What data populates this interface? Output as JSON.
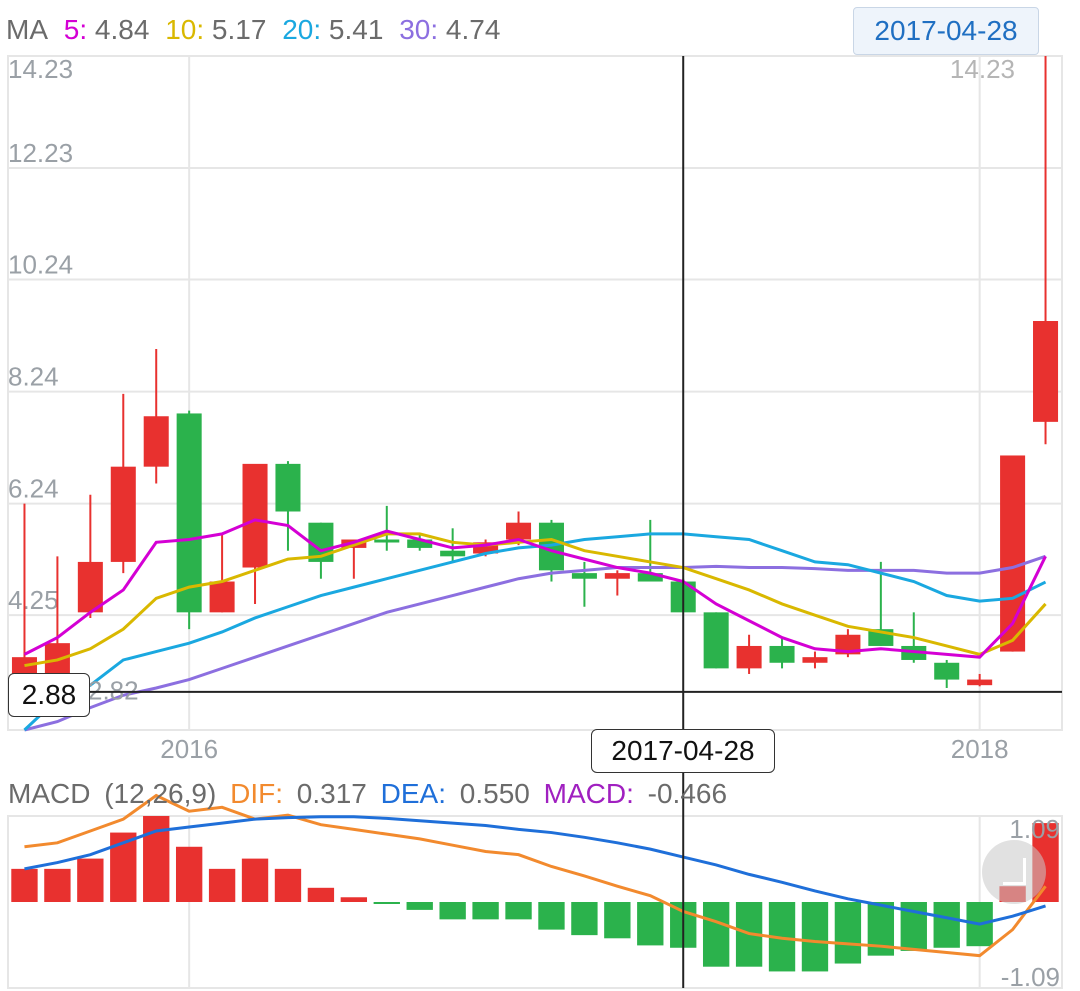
{
  "ma_legend": {
    "label": "MA",
    "ma5_label": "5:",
    "ma5_value": "4.84",
    "ma10_label": "10:",
    "ma10_value": "5.17",
    "ma20_label": "20:",
    "ma20_value": "5.41",
    "ma30_label": "30:",
    "ma30_value": "4.74"
  },
  "selected_date": "2017-04-28",
  "crosshair": {
    "x_label": "2017-04-28",
    "y_label": "2.88"
  },
  "macd_legend": {
    "label": "MACD",
    "params": "(12,26,9)",
    "dif_label": "DIF:",
    "dif_value": "0.317",
    "dea_label": "DEA:",
    "dea_value": "0.550",
    "macd_label": "MACD:",
    "macd_value": "-0.466"
  },
  "colors": {
    "up": "#e8312f",
    "down": "#2bb24c",
    "ma5": "#d400d4",
    "ma10": "#d9b800",
    "ma20": "#1aa8e0",
    "ma30": "#8c6fe0",
    "dif": "#f28a2e",
    "dea": "#1f6fd9",
    "grid": "#e6e6e6",
    "axis_text": "#9aa0a6",
    "crosshair": "#222222"
  },
  "chart_data": [
    {
      "type": "candlestick",
      "title": "",
      "y_ticks": [
        "14.23",
        "12.23",
        "10.24",
        "8.24",
        "6.24",
        "4.25"
      ],
      "y_right_tick": "14.23",
      "max_label": "14.23",
      "min_label": "2.82",
      "x_ticks": [
        "2016",
        "2018"
      ],
      "ylim": [
        2.2,
        14.23
      ],
      "candles": [
        {
          "o": 2.82,
          "h": 6.24,
          "l": 2.7,
          "c": 3.5
        },
        {
          "o": 3.2,
          "h": 5.3,
          "l": 3.0,
          "c": 3.75
        },
        {
          "o": 4.3,
          "h": 6.4,
          "l": 4.2,
          "c": 5.2
        },
        {
          "o": 5.2,
          "h": 8.2,
          "l": 5.0,
          "c": 6.9
        },
        {
          "o": 6.9,
          "h": 9.0,
          "l": 6.6,
          "c": 7.8
        },
        {
          "o": 7.85,
          "h": 7.9,
          "l": 4.0,
          "c": 4.3
        },
        {
          "o": 4.3,
          "h": 5.7,
          "l": 4.3,
          "c": 4.85
        },
        {
          "o": 5.1,
          "h": 6.9,
          "l": 4.45,
          "c": 6.95
        },
        {
          "o": 6.95,
          "h": 7.0,
          "l": 5.4,
          "c": 6.1
        },
        {
          "o": 5.9,
          "h": 5.9,
          "l": 4.9,
          "c": 5.2
        },
        {
          "o": 5.45,
          "h": 5.6,
          "l": 4.9,
          "c": 5.6
        },
        {
          "o": 5.6,
          "h": 6.2,
          "l": 5.4,
          "c": 5.55
        },
        {
          "o": 5.6,
          "h": 5.7,
          "l": 5.4,
          "c": 5.45
        },
        {
          "o": 5.4,
          "h": 5.8,
          "l": 5.2,
          "c": 5.3
        },
        {
          "o": 5.35,
          "h": 5.6,
          "l": 5.3,
          "c": 5.55
        },
        {
          "o": 5.6,
          "h": 6.1,
          "l": 5.5,
          "c": 5.9
        },
        {
          "o": 5.9,
          "h": 5.95,
          "l": 4.85,
          "c": 5.05
        },
        {
          "o": 5.0,
          "h": 5.2,
          "l": 4.4,
          "c": 4.9
        },
        {
          "o": 4.9,
          "h": 5.05,
          "l": 4.6,
          "c": 5.0
        },
        {
          "o": 5.0,
          "h": 5.95,
          "l": 4.9,
          "c": 4.85
        },
        {
          "o": 4.85,
          "h": 4.9,
          "l": 4.3,
          "c": 4.3
        },
        {
          "o": 4.3,
          "h": 4.3,
          "l": 3.3,
          "c": 3.3
        },
        {
          "o": 3.3,
          "h": 3.9,
          "l": 3.2,
          "c": 3.7
        },
        {
          "o": 3.7,
          "h": 3.85,
          "l": 3.3,
          "c": 3.4
        },
        {
          "o": 3.4,
          "h": 3.6,
          "l": 3.3,
          "c": 3.5
        },
        {
          "o": 3.55,
          "h": 4.0,
          "l": 3.5,
          "c": 3.9
        },
        {
          "o": 4.0,
          "h": 5.2,
          "l": 3.7,
          "c": 3.7
        },
        {
          "o": 3.7,
          "h": 4.3,
          "l": 3.4,
          "c": 3.45
        },
        {
          "o": 3.4,
          "h": 3.45,
          "l": 2.95,
          "c": 3.1
        },
        {
          "o": 3.0,
          "h": 3.2,
          "l": 2.98,
          "c": 3.1
        },
        {
          "o": 3.6,
          "h": 7.1,
          "l": 3.6,
          "c": 7.1
        },
        {
          "o": 7.7,
          "h": 14.23,
          "l": 7.3,
          "c": 9.5
        }
      ],
      "ma5": [
        3.55,
        3.85,
        4.3,
        4.7,
        5.55,
        5.6,
        5.7,
        5.95,
        5.85,
        5.4,
        5.55,
        5.75,
        5.6,
        5.45,
        5.5,
        5.6,
        5.4,
        5.25,
        5.1,
        5.0,
        4.85,
        4.45,
        4.15,
        3.85,
        3.65,
        3.6,
        3.65,
        3.6,
        3.55,
        3.5,
        4.1,
        5.3
      ],
      "ma10": [
        3.35,
        3.45,
        3.65,
        4.0,
        4.55,
        4.75,
        4.85,
        5.05,
        5.25,
        5.3,
        5.5,
        5.7,
        5.7,
        5.55,
        5.5,
        5.55,
        5.6,
        5.4,
        5.3,
        5.2,
        5.1,
        4.9,
        4.7,
        4.45,
        4.25,
        4.05,
        3.95,
        3.85,
        3.7,
        3.55,
        3.8,
        4.45
      ],
      "ma20": [
        2.2,
        2.75,
        3.0,
        3.45,
        3.6,
        3.75,
        3.95,
        4.2,
        4.4,
        4.6,
        4.75,
        4.9,
        5.05,
        5.2,
        5.35,
        5.45,
        5.5,
        5.6,
        5.65,
        5.7,
        5.7,
        5.65,
        5.6,
        5.4,
        5.2,
        5.15,
        5.0,
        4.85,
        4.6,
        4.5,
        4.55,
        4.84
      ],
      "ma30": [
        2.2,
        2.35,
        2.6,
        2.82,
        2.95,
        3.1,
        3.3,
        3.5,
        3.7,
        3.9,
        4.1,
        4.3,
        4.45,
        4.6,
        4.75,
        4.9,
        5.0,
        5.05,
        5.1,
        5.1,
        5.1,
        5.12,
        5.1,
        5.1,
        5.08,
        5.05,
        5.05,
        5.05,
        5.0,
        5.0,
        5.1,
        5.3
      ]
    },
    {
      "type": "macd",
      "title": "MACD",
      "y_ticks": [
        "1.09",
        "-1.09"
      ],
      "ylim": [
        -1.09,
        1.09
      ],
      "hist": [
        0.42,
        0.42,
        0.55,
        0.88,
        1.09,
        0.7,
        0.42,
        0.55,
        0.42,
        0.18,
        0.06,
        -0.02,
        -0.1,
        -0.22,
        -0.22,
        -0.22,
        -0.35,
        -0.42,
        -0.46,
        -0.55,
        -0.58,
        -0.82,
        -0.82,
        -0.88,
        -0.88,
        -0.78,
        -0.68,
        -0.62,
        -0.58,
        -0.56,
        0.2,
        1.0
      ],
      "dif": [
        0.7,
        0.75,
        0.9,
        1.05,
        1.35,
        1.15,
        1.2,
        1.05,
        1.1,
        0.98,
        0.92,
        0.86,
        0.8,
        0.72,
        0.64,
        0.6,
        0.45,
        0.33,
        0.2,
        0.08,
        -0.12,
        -0.25,
        -0.4,
        -0.46,
        -0.5,
        -0.53,
        -0.56,
        -0.6,
        -0.64,
        -0.68,
        -0.35,
        0.2
      ],
      "dea": [
        0.42,
        0.5,
        0.6,
        0.75,
        0.9,
        0.95,
        1.0,
        1.05,
        1.07,
        1.08,
        1.08,
        1.06,
        1.03,
        1.0,
        0.97,
        0.92,
        0.88,
        0.82,
        0.75,
        0.67,
        0.57,
        0.47,
        0.35,
        0.25,
        0.14,
        0.04,
        -0.04,
        -0.12,
        -0.2,
        -0.28,
        -0.18,
        -0.05
      ]
    }
  ]
}
